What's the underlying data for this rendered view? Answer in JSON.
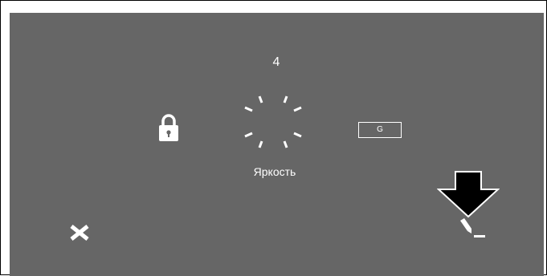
{
  "display": {
    "level_value": "4",
    "label": "Яркость",
    "g_button_label": "G"
  },
  "icons": {
    "lock": "lock-icon",
    "brightness": "brightness-sun-icon",
    "close": "close-icon",
    "arrow": "down-arrow-icon",
    "pen": "pen-icon"
  },
  "colors": {
    "background": "#666666",
    "foreground": "#ffffff",
    "arrow_fill": "#000000"
  }
}
